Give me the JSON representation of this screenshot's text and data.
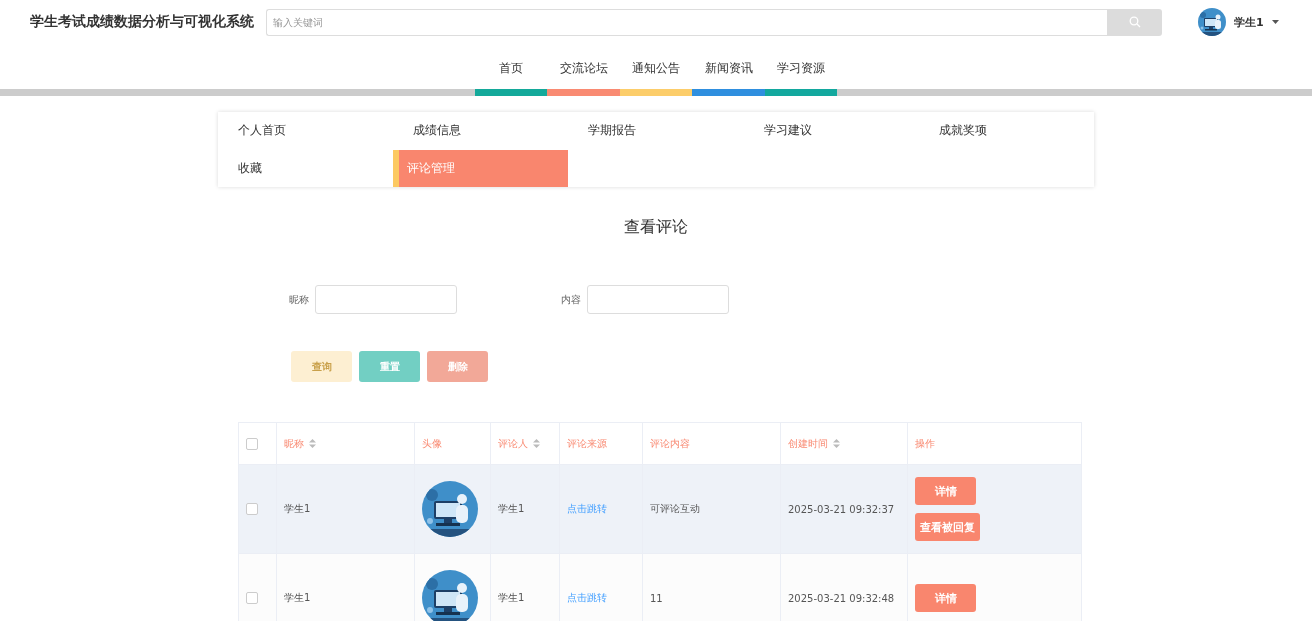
{
  "header": {
    "title": "学生考试成绩数据分析与可视化系统",
    "search": {
      "placeholder": "输入关键词"
    },
    "user": {
      "avatar": {
        "kind": "picture"
      },
      "name": "学生1"
    }
  },
  "nav": [
    {
      "label": "首页",
      "color": "#14a99a"
    },
    {
      "label": "交流论坛",
      "color": "#f98a72"
    },
    {
      "label": "通知公告",
      "color": "#fccd6a"
    },
    {
      "label": "新闻资讯",
      "color": "#2f8fdf"
    },
    {
      "label": "学习资源",
      "color": "#13a89e"
    }
  ],
  "submenu": [
    {
      "label": "个人首页",
      "selected": false
    },
    {
      "label": "成绩信息",
      "selected": false
    },
    {
      "label": "学期报告",
      "selected": false
    },
    {
      "label": "学习建议",
      "selected": false
    },
    {
      "label": "成就奖项",
      "selected": false
    },
    {
      "label": "收藏",
      "selected": false
    },
    {
      "label": "评论管理",
      "selected": true
    }
  ],
  "page_title": "查看评论",
  "filters": [
    {
      "label": "昵称"
    },
    {
      "label": "内容"
    }
  ],
  "actions": [
    {
      "label": "查询",
      "kind": "query"
    },
    {
      "label": "重置",
      "kind": "reset"
    },
    {
      "label": "删除",
      "kind": "delete"
    }
  ],
  "table": {
    "columns": [
      {
        "label": "昵称",
        "sortable": true
      },
      {
        "label": "头像",
        "sortable": false
      },
      {
        "label": "评论人",
        "sortable": true
      },
      {
        "label": "评论来源",
        "sortable": false
      },
      {
        "label": "评论内容",
        "sortable": false
      },
      {
        "label": "创建时间",
        "sortable": true
      },
      {
        "label": "操作",
        "sortable": false
      }
    ],
    "header_checked": false,
    "rows": [
      {
        "checked": false,
        "hovered": true,
        "nickname": "学生1",
        "avatar": {
          "kind": "picture"
        },
        "commenter": "学生1",
        "source": "点击跳转",
        "content": "可评论互动",
        "created": "2025-03-21 09:32:37",
        "buttons": [
          "详情",
          "查看被回复"
        ]
      },
      {
        "checked": false,
        "hovered": false,
        "nickname": "学生1",
        "avatar": {
          "kind": "picture"
        },
        "commenter": "学生1",
        "source": "点击跳转",
        "content": "11",
        "created": "2025-03-21 09:32:48",
        "buttons": [
          "详情"
        ]
      }
    ]
  }
}
